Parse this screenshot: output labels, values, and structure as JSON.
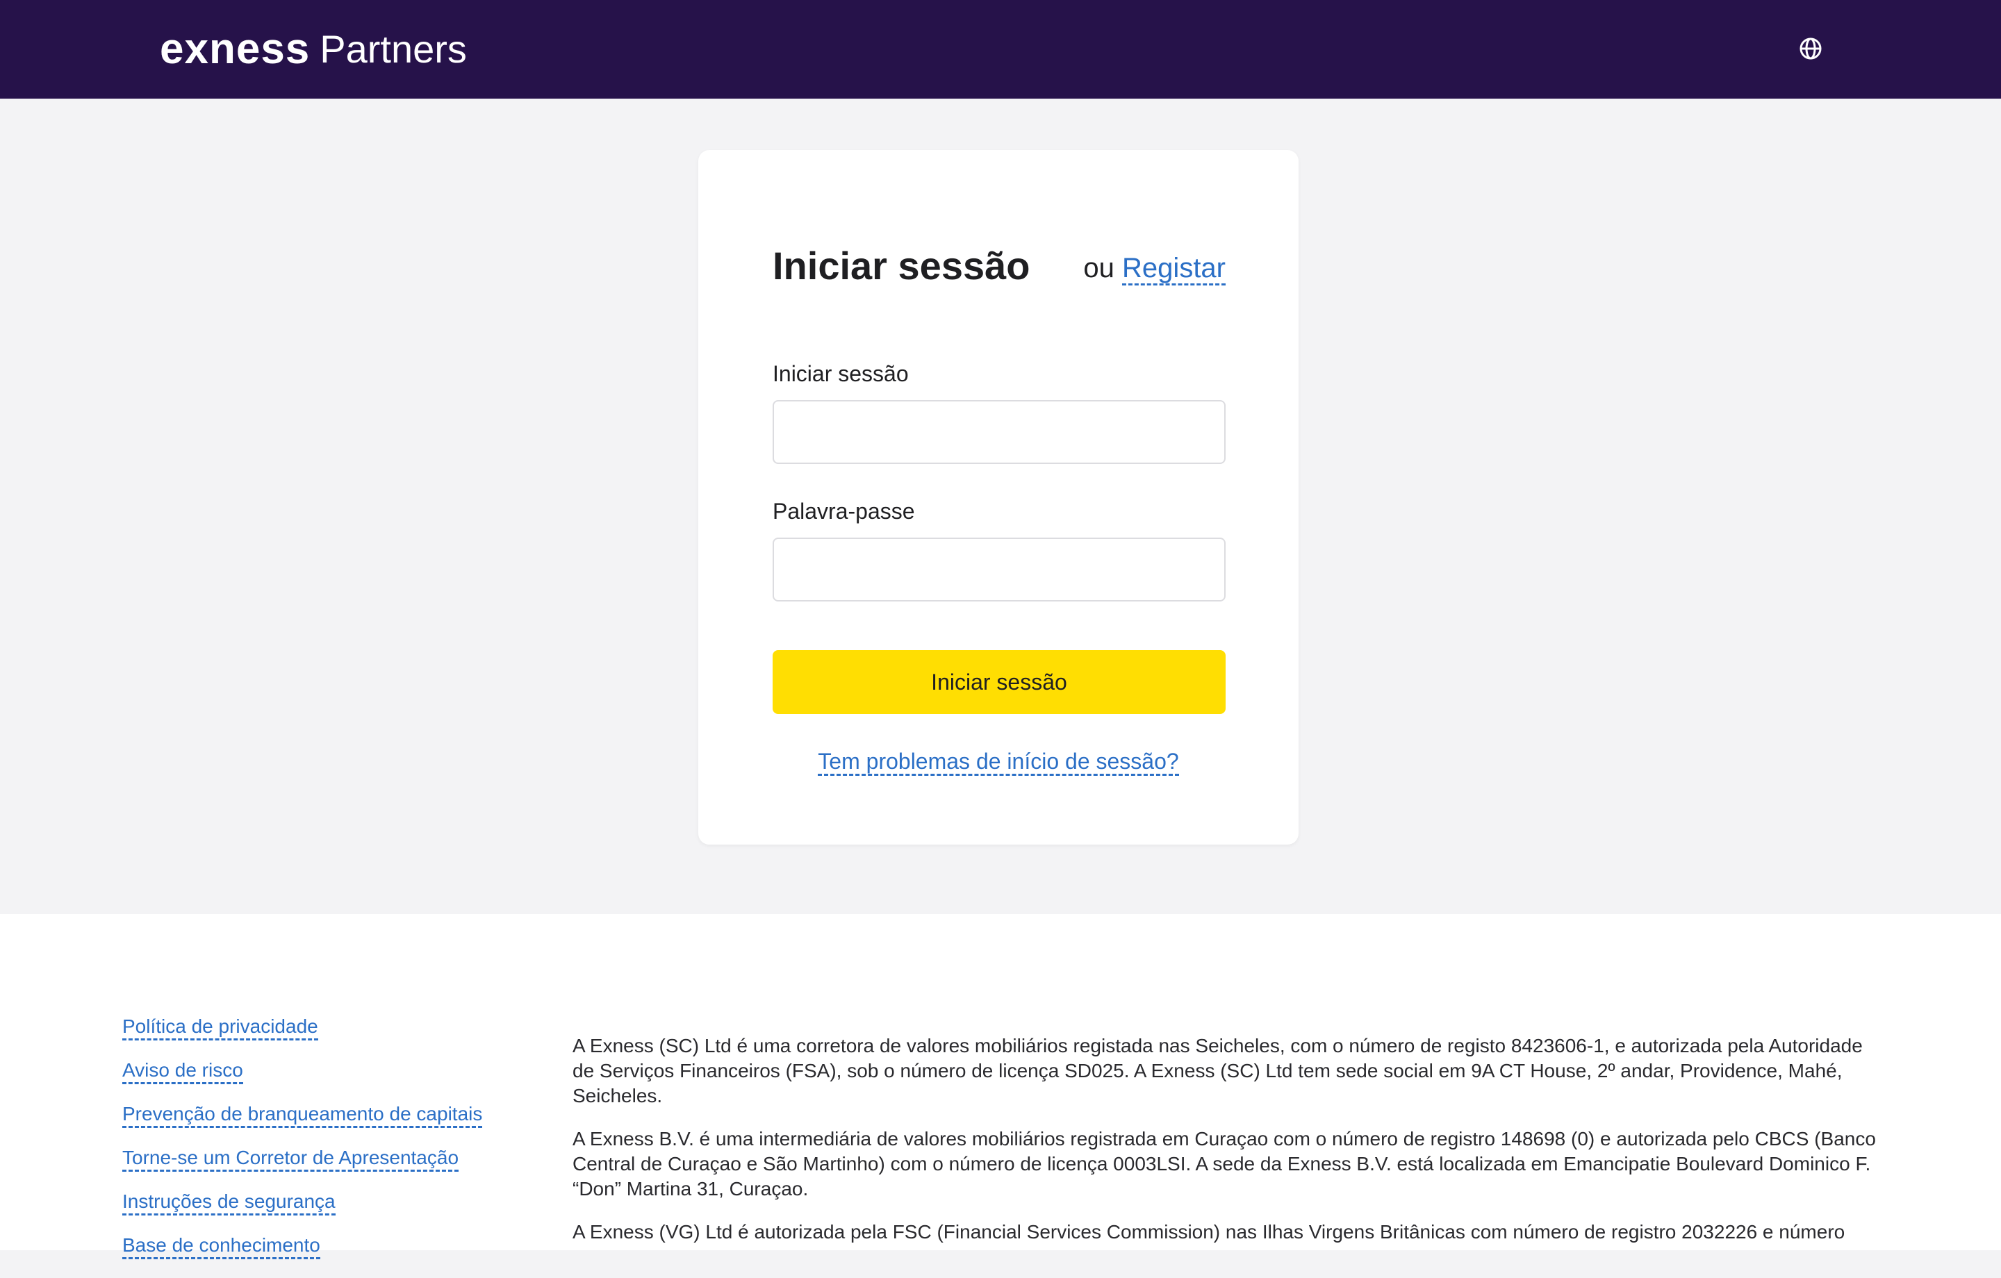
{
  "header": {
    "brand": "exness",
    "product": "Partners",
    "language_icon": "globe-icon"
  },
  "login": {
    "title": "Iniciar sessão",
    "or_text": "ou",
    "register_link": "Registar",
    "login_label": "Iniciar sessão",
    "login_value": "",
    "password_label": "Palavra-passe",
    "password_value": "",
    "submit_label": "Iniciar sessão",
    "trouble_link": "Tem problemas de início de sessão?"
  },
  "footer": {
    "links": [
      "Política de privacidade",
      "Aviso de risco",
      "Prevenção de branqueamento de capitais",
      "Torne-se um Corretor de Apresentação",
      "Instruções de segurança",
      "Base de conhecimento"
    ],
    "legal": [
      "A Exness (SC) Ltd é uma corretora de valores mobiliários registada nas Seicheles, com o número de registo 8423606-1, e autorizada pela Autoridade de Serviços Financeiros (FSA), sob o número de licença SD025. A Exness (SC) Ltd tem sede social em 9A CT House, 2º andar, Providence, Mahé, Seicheles.",
      "A Exness B.V. é uma intermediária de valores mobiliários registrada em Curaçao com o número de registro 148698 (0) e autorizada pelo CBCS (Banco Central de Curaçao e São Martinho) com o número de licença 0003LSI. A sede da Exness B.V. está localizada em Emancipatie Boulevard Dominico F. “Don” Martina 31, Curaçao.",
      "A Exness (VG) Ltd é autorizada pela FSC (Financial Services Commission) nas Ilhas Virgens Britânicas com número de registro 2032226 e número"
    ]
  },
  "colors": {
    "header_bg": "#26124a",
    "accent_yellow": "#ffde02",
    "link_blue": "#2b6fc6",
    "page_bg": "#f3f3f5"
  }
}
